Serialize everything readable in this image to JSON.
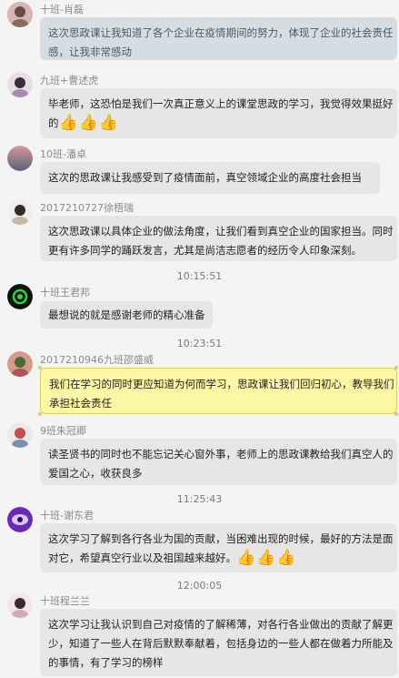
{
  "messages": [
    {
      "sender": "十班-肖磊",
      "lines": [
        "这次思政课让我知道了各个企业在疫情期间的努力，体现了企业的社会责任",
        "感，让我非常感动"
      ],
      "thumbs": 0
    },
    {
      "sender": "九班+曹述虎",
      "lines": [
        "毕老师，这恐怕是我们一次真正意义上的课堂思政的学习，我觉得效果挺好",
        "的"
      ],
      "thumbs": 3
    },
    {
      "sender": "10班-潘卓",
      "lines": [
        "这次的思政课让我感受到了疫情面前，真空领域企业的高度社会担当"
      ],
      "thumbs": 0
    },
    {
      "sender": "2017210727徐梧瑞",
      "lines": [
        "这次思政课以具体企业的做法角度，让我们看到真空企业的国家担当。同时",
        "更有许多同学的踊跃发言，尤其是尚洁志愿者的经历令人印象深刻。"
      ],
      "thumbs": 0
    },
    {
      "sender": "十班王君邦",
      "lines": [
        "最想说的就是感谢老师的精心准备"
      ],
      "thumbs": 0
    },
    {
      "sender": "2017210946九班邵盛威",
      "lines": [
        "我们在学习的同时更应知道为何而学习，思政课让我们回归初心，教导我们",
        "承担社会责任"
      ],
      "thumbs": 0
    },
    {
      "sender": "9班朱冠卿",
      "lines": [
        "读圣贤书的同时也不能忘记关心窗外事，老师上的思政课教给我们真空人的",
        "爱国之心，收获良多"
      ],
      "thumbs": 0
    },
    {
      "sender": "十班-谢东君",
      "lines": [
        "这次学习了解到各行各业为国的贡献，当困难出现的时候，最好的方法是面",
        "对它，希望真空行业以及祖国越来越好。"
      ],
      "thumbs": 3
    },
    {
      "sender": "十班程兰兰",
      "lines": [
        "这次学习让我认识到自己对疫情的了解稀薄，对各行各业做出的贡献了解更",
        "少，知道了一些人在背后默默奉献着，包括身边的一些人都在做着力所能及",
        "的事情，有了学习的榜样"
      ],
      "thumbs": 0
    }
  ],
  "timestamps": [
    "10:15:51",
    "10:23:51",
    "11:25:43",
    "12:00:05"
  ],
  "thumb_glyph": "👍",
  "colors": {
    "background": "#f4f4f4",
    "bubble": "#e6e6e6",
    "bubble_first": "#d5dde2",
    "highlight": "#fbf7a4",
    "highlight_border": "#d9cc5c"
  }
}
